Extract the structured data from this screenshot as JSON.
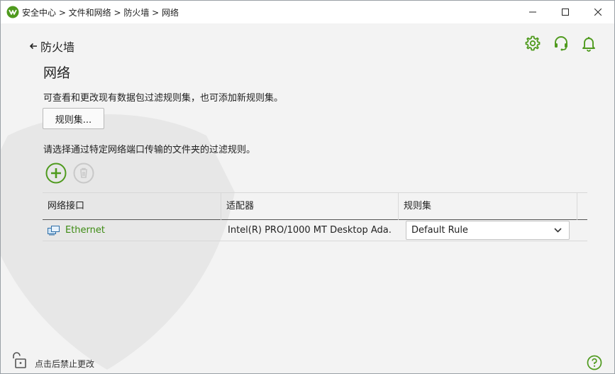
{
  "window": {
    "title": "安全中心 > 文件和网络 > 防火墙 > 网络",
    "minimize_icon": "minimize-icon",
    "maximize_icon": "maximize-icon",
    "close_icon": "close-icon"
  },
  "nav": {
    "back_label": "防火墙"
  },
  "page": {
    "title": "网络",
    "description": "可查看和更改现有数据包过滤规则集，也可添加新规则集。",
    "rules_button": "规则集...",
    "rules_hint": "请选择通过特定网络端口传输的文件夹的过滤规则。"
  },
  "toolbar": {
    "add_icon": "plus-circle-icon",
    "delete_icon": "trash-icon"
  },
  "table": {
    "columns": [
      "网络接口",
      "适配器",
      "规则集"
    ],
    "rows": [
      {
        "interface": "Ethernet",
        "adapter": "Intel(R) PRO/1000 MT Desktop Ada...",
        "ruleset": "Default Rule"
      }
    ]
  },
  "footer": {
    "lock_text": "点击后禁止更改"
  },
  "colors": {
    "accent": "#4f9a1e",
    "link": "#3d8b13",
    "background": "#f3f3f3"
  }
}
